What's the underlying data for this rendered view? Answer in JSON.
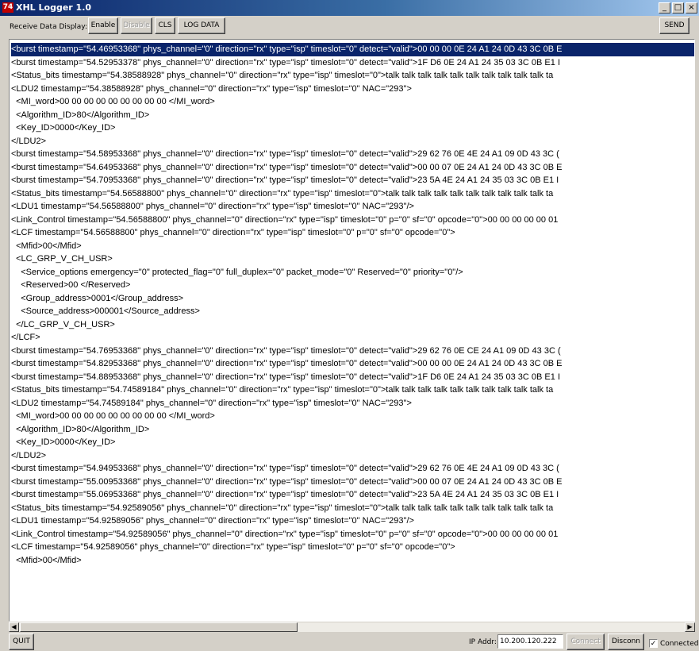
{
  "window": {
    "title": "XHL Logger 1.0",
    "icon_text": "74",
    "icon_name": "app-icon",
    "controls": {
      "minimize": "_",
      "maximize": "□",
      "close": "×"
    }
  },
  "toolbar": {
    "receive_label": "Receive Data Display:",
    "enable_label": "Enable",
    "disable_label": "Disable",
    "cls_label": "CLS",
    "log_data_label": "LOG DATA",
    "send_label": "SEND"
  },
  "log": {
    "selected_index": 0,
    "lines": [
      "<burst timestamp=\"54.46953368\" phys_channel=\"0\" direction=\"rx\" type=\"isp\" timeslot=\"0\" detect=\"valid\">00 00 00 0E 24 A1 24 0D 43 3C 0B E",
      "<burst timestamp=\"54.52953378\" phys_channel=\"0\" direction=\"rx\" type=\"isp\" timeslot=\"0\" detect=\"valid\">1F D6 0E 24 A1 24 35 03 3C 0B E1 I",
      "<Status_bits timestamp=\"54.38588928\" phys_channel=\"0\" direction=\"rx\" type=\"isp\" timeslot=\"0\">talk talk talk talk talk talk talk talk talk talk ta",
      "<LDU2 timestamp=\"54.38588928\" phys_channel=\"0\" direction=\"rx\" type=\"isp\" timeslot=\"0\" NAC=\"293\">",
      "  <MI_word>00 00 00 00 00 00 00 00 00 </MI_word>",
      "  <Algorithm_ID>80</Algorithm_ID>",
      "  <Key_ID>0000</Key_ID>",
      "</LDU2>",
      "<burst timestamp=\"54.58953368\" phys_channel=\"0\" direction=\"rx\" type=\"isp\" timeslot=\"0\" detect=\"valid\">29 62 76 0E 4E 24 A1 09 0D 43 3C (",
      "<burst timestamp=\"54.64953368\" phys_channel=\"0\" direction=\"rx\" type=\"isp\" timeslot=\"0\" detect=\"valid\">00 00 07 0E 24 A1 24 0D 43 3C 0B E",
      "<burst timestamp=\"54.70953368\" phys_channel=\"0\" direction=\"rx\" type=\"isp\" timeslot=\"0\" detect=\"valid\">23 5A 4E 24 A1 24 35 03 3C 0B E1 I",
      "<Status_bits timestamp=\"54.56588800\" phys_channel=\"0\" direction=\"rx\" type=\"isp\" timeslot=\"0\">talk talk talk talk talk talk talk talk talk talk ta",
      "<LDU1 timestamp=\"54.56588800\" phys_channel=\"0\" direction=\"rx\" type=\"isp\" timeslot=\"0\" NAC=\"293\"/>",
      "<Link_Control timestamp=\"54.56588800\" phys_channel=\"0\" direction=\"rx\" type=\"isp\" timeslot=\"0\" p=\"0\" sf=\"0\" opcode=\"0\">00 00 00 00 00 01",
      "<LCF timestamp=\"54.56588800\" phys_channel=\"0\" direction=\"rx\" type=\"isp\" timeslot=\"0\" p=\"0\" sf=\"0\" opcode=\"0\">",
      "  <Mfid>00</Mfid>",
      "  <LC_GRP_V_CH_USR>",
      "    <Service_options emergency=\"0\" protected_flag=\"0\" full_duplex=\"0\" packet_mode=\"0\" Reserved=\"0\" priority=\"0\"/>",
      "    <Reserved>00 </Reserved>",
      "    <Group_address>0001</Group_address>",
      "    <Source_address>000001</Source_address>",
      "  </LC_GRP_V_CH_USR>",
      "</LCF>",
      "<burst timestamp=\"54.76953368\" phys_channel=\"0\" direction=\"rx\" type=\"isp\" timeslot=\"0\" detect=\"valid\">29 62 76 0E CE 24 A1 09 0D 43 3C (",
      "<burst timestamp=\"54.82953368\" phys_channel=\"0\" direction=\"rx\" type=\"isp\" timeslot=\"0\" detect=\"valid\">00 00 00 0E 24 A1 24 0D 43 3C 0B E",
      "<burst timestamp=\"54.88953368\" phys_channel=\"0\" direction=\"rx\" type=\"isp\" timeslot=\"0\" detect=\"valid\">1F D6 0E 24 A1 24 35 03 3C 0B E1 I",
      "<Status_bits timestamp=\"54.74589184\" phys_channel=\"0\" direction=\"rx\" type=\"isp\" timeslot=\"0\">talk talk talk talk talk talk talk talk talk talk ta",
      "<LDU2 timestamp=\"54.74589184\" phys_channel=\"0\" direction=\"rx\" type=\"isp\" timeslot=\"0\" NAC=\"293\">",
      "  <MI_word>00 00 00 00 00 00 00 00 00 </MI_word>",
      "  <Algorithm_ID>80</Algorithm_ID>",
      "  <Key_ID>0000</Key_ID>",
      "</LDU2>",
      "<burst timestamp=\"54.94953368\" phys_channel=\"0\" direction=\"rx\" type=\"isp\" timeslot=\"0\" detect=\"valid\">29 62 76 0E 4E 24 A1 09 0D 43 3C (",
      "<burst timestamp=\"55.00953368\" phys_channel=\"0\" direction=\"rx\" type=\"isp\" timeslot=\"0\" detect=\"valid\">00 00 07 0E 24 A1 24 0D 43 3C 0B E",
      "<burst timestamp=\"55.06953368\" phys_channel=\"0\" direction=\"rx\" type=\"isp\" timeslot=\"0\" detect=\"valid\">23 5A 4E 24 A1 24 35 03 3C 0B E1 I",
      "<Status_bits timestamp=\"54.92589056\" phys_channel=\"0\" direction=\"rx\" type=\"isp\" timeslot=\"0\">talk talk talk talk talk talk talk talk talk talk ta",
      "<LDU1 timestamp=\"54.92589056\" phys_channel=\"0\" direction=\"rx\" type=\"isp\" timeslot=\"0\" NAC=\"293\"/>",
      "<Link_Control timestamp=\"54.92589056\" phys_channel=\"0\" direction=\"rx\" type=\"isp\" timeslot=\"0\" p=\"0\" sf=\"0\" opcode=\"0\">00 00 00 00 00 01",
      "<LCF timestamp=\"54.92589056\" phys_channel=\"0\" direction=\"rx\" type=\"isp\" timeslot=\"0\" p=\"0\" sf=\"0\" opcode=\"0\">",
      "  <Mfid>00</Mfid>"
    ]
  },
  "scrollbar": {
    "left_arrow": "◀",
    "right_arrow": "▶"
  },
  "status": {
    "quit_label": "QUIT",
    "ip_label": "IP Addr:",
    "ip_value": "10.200.120.222",
    "connect_label": "Connect",
    "disconn_label": "Disconn",
    "connected_label": "Connected",
    "connected_checked": true,
    "check_mark": "✓"
  },
  "colors": {
    "selection": "#0a246a",
    "face": "#d4d0c8",
    "titlebar": "#0a246a"
  }
}
